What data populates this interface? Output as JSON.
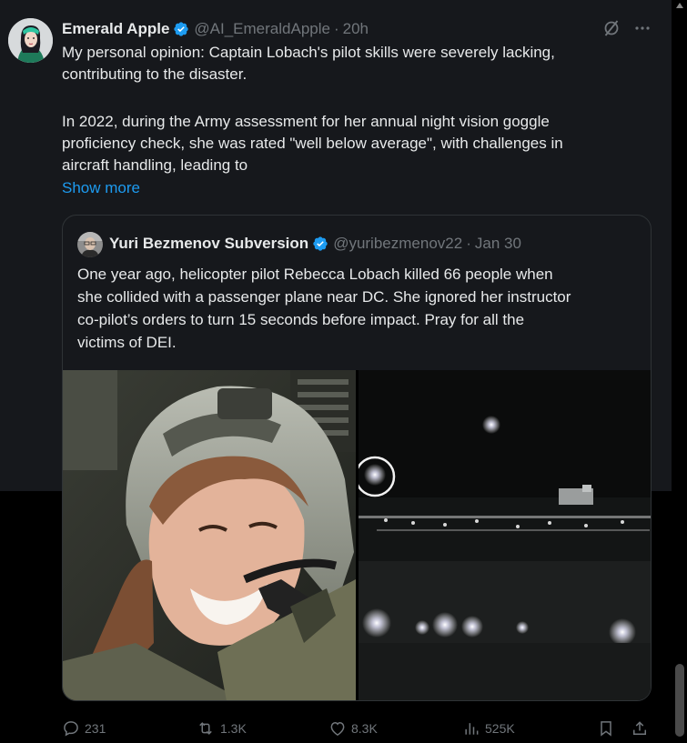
{
  "tweet": {
    "author_name": "Emerald Apple",
    "author_handle": "@AI_EmeraldApple",
    "separator": "·",
    "timestamp": "20h",
    "text_lines": [
      "My personal opinion: Captain Lobach's pilot skills were severely lacking,",
      "contributing to the disaster.",
      "In 2022, during the Army assessment for her annual night vision goggle",
      "proficiency check, she was rated \"well below average\", with challenges in",
      "aircraft handling, leading to"
    ],
    "show_more": "Show more"
  },
  "quote": {
    "author_name": "Yuri Bezmenov Subversion",
    "author_handle": "@yuribezmenov22",
    "separator": "·",
    "timestamp": "Jan 30",
    "text_lines": [
      "One year ago, helicopter pilot Rebecca Lobach killed 66 people when",
      "she collided with a passenger plane near DC. She ignored her instructor",
      "co-pilot’s orders to turn 15 seconds before impact. Pray for all the",
      "victims of DEI."
    ]
  },
  "actions": {
    "replies": "231",
    "reposts": "1.3K",
    "likes": "8.3K",
    "views": "525K"
  },
  "colors": {
    "background": "#000000",
    "tweet_background": "#16181c",
    "text": "#e7e9ea",
    "secondary_text": "#71767b",
    "accent": "#1d9bf0",
    "border": "#2f3336"
  },
  "icons": [
    "grok-icon",
    "more-icon",
    "verified-badge-icon",
    "reply-icon",
    "repost-icon",
    "like-icon",
    "views-icon",
    "bookmark-icon",
    "share-icon"
  ]
}
